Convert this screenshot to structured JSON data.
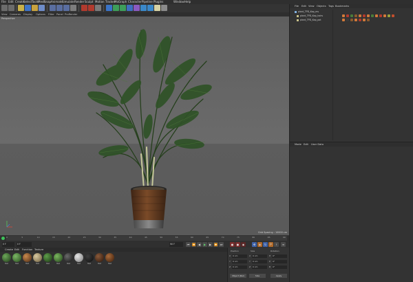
{
  "menubar": [
    "File",
    "Edit",
    "Create",
    "Select",
    "Tools",
    "Mesh",
    "Snap",
    "Animate",
    "Simulate",
    "Render",
    "Sculpt",
    "Motion Tracker",
    "MoGraph",
    "Character",
    "Pipeline",
    "Plugins",
    "Window",
    "Help"
  ],
  "viewport": {
    "menu": [
      "View",
      "Cameras",
      "Display",
      "Options",
      "Filter",
      "Panel",
      "ProRender"
    ],
    "camera_label": "Perspective",
    "grid_spacing": "Grid Spacing : 10000 cm"
  },
  "object_manager": {
    "menu": [
      "File",
      "Edit",
      "View",
      "Objects",
      "Tags",
      "Bookmarks"
    ],
    "objects": [
      "plant_TPD_Kap_ms",
      "plant_TPD_Kap_hairs",
      "plant_TPD_Kap_pot"
    ]
  },
  "attribute_manager": {
    "menu": [
      "Mode",
      "Edit",
      "User Data"
    ]
  },
  "timeline": {
    "start_frame": "0 F",
    "preview_start": "0 F",
    "preview_end": "90 F",
    "ticks": [
      "0",
      "5",
      "10",
      "15",
      "20",
      "25",
      "30",
      "35",
      "40",
      "45",
      "50",
      "55",
      "60",
      "65",
      "70",
      "75",
      "80",
      "85",
      "90"
    ]
  },
  "material_manager": {
    "menu": [
      "Create",
      "Edit",
      "Function",
      "Texture"
    ],
    "materials": [
      "Mat",
      "Mat",
      "Mat",
      "Mat",
      "Mat",
      "Mat",
      "Mat",
      "Mat",
      "Mat",
      "Mat",
      "Mat"
    ]
  },
  "coordinates": {
    "headers": [
      "Position",
      "Size",
      "Rotation"
    ],
    "rows": [
      {
        "l1": "X",
        "v1": "0 cm",
        "l2": "X",
        "v2": "0 cm",
        "l3": "H",
        "v3": "0°"
      },
      {
        "l1": "Y",
        "v1": "0 cm",
        "l2": "Y",
        "v2": "0 cm",
        "l3": "P",
        "v3": "0°"
      },
      {
        "l1": "Z",
        "v1": "0 cm",
        "l2": "Z",
        "v2": "0 cm",
        "l3": "B",
        "v3": "0°"
      }
    ],
    "mode": "Object (Rel)",
    "size_mode": "Size",
    "apply": "Apply"
  },
  "colors": {
    "background": "#3b3b3b",
    "panel": "#333333",
    "viewport": "#6b6b6b",
    "play_green": "#3ec45a",
    "record_red": "#7a2b2b"
  }
}
